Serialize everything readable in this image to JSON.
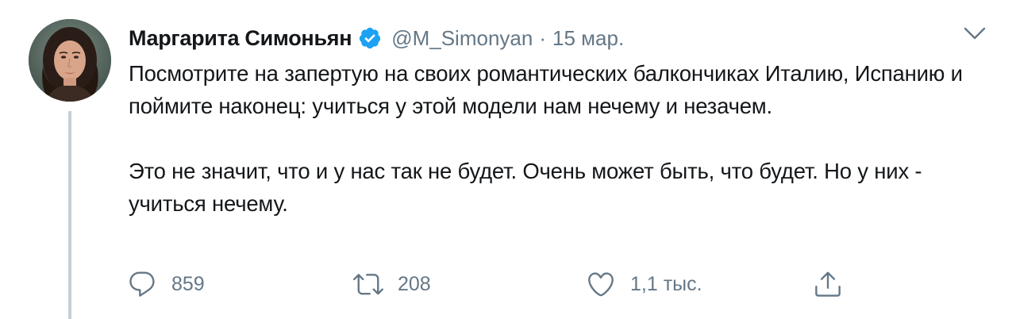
{
  "tweet": {
    "author_name": "Маргарита Симоньян",
    "handle": "@M_Simonyan",
    "separator": "·",
    "date": "15 мар.",
    "paragraphs": [
      "Посмотрите на запертую на своих романтических балкончиках Италию, Испанию и поймите наконец: учиться у этой модели нам нечему и незачем.",
      "Это не значит, что и у нас так не будет. Очень может быть, что будет. Но у них - учиться нечему."
    ],
    "actions": {
      "reply_count": "859",
      "retweet_count": "208",
      "like_count": "1,1 тыс."
    },
    "icons": {
      "verified": "verified-badge-icon",
      "menu": "chevron-down-icon",
      "reply": "reply-bubble-icon",
      "retweet": "retweet-icon",
      "like": "heart-icon",
      "share": "share-upload-icon"
    },
    "colors": {
      "text": "#14171a",
      "muted": "#657786",
      "verified": "#1da1f2",
      "thread_line": "#c4cfd6"
    }
  }
}
